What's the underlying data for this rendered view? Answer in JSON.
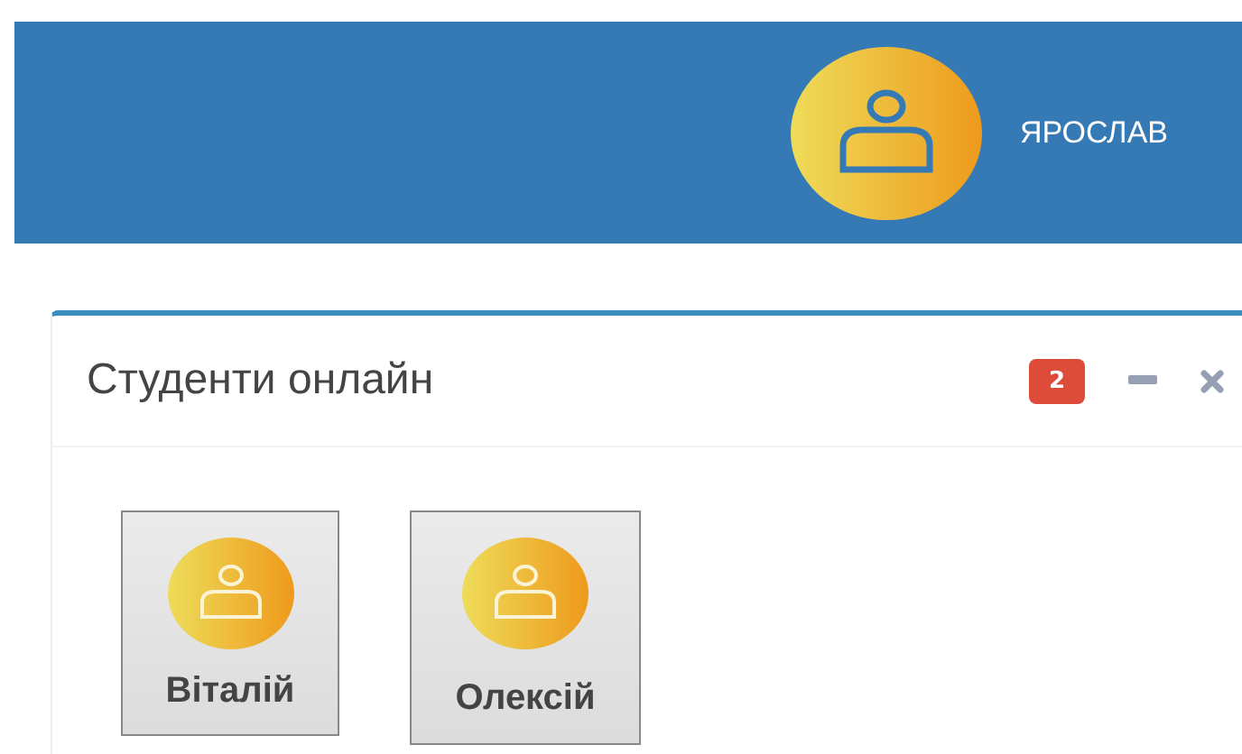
{
  "header": {
    "user_name": "ЯРОСЛАВ"
  },
  "panel": {
    "title": "Студенти онлайн",
    "badge": "2",
    "students": [
      {
        "name": "Віталій"
      },
      {
        "name": "Олексій"
      }
    ]
  }
}
